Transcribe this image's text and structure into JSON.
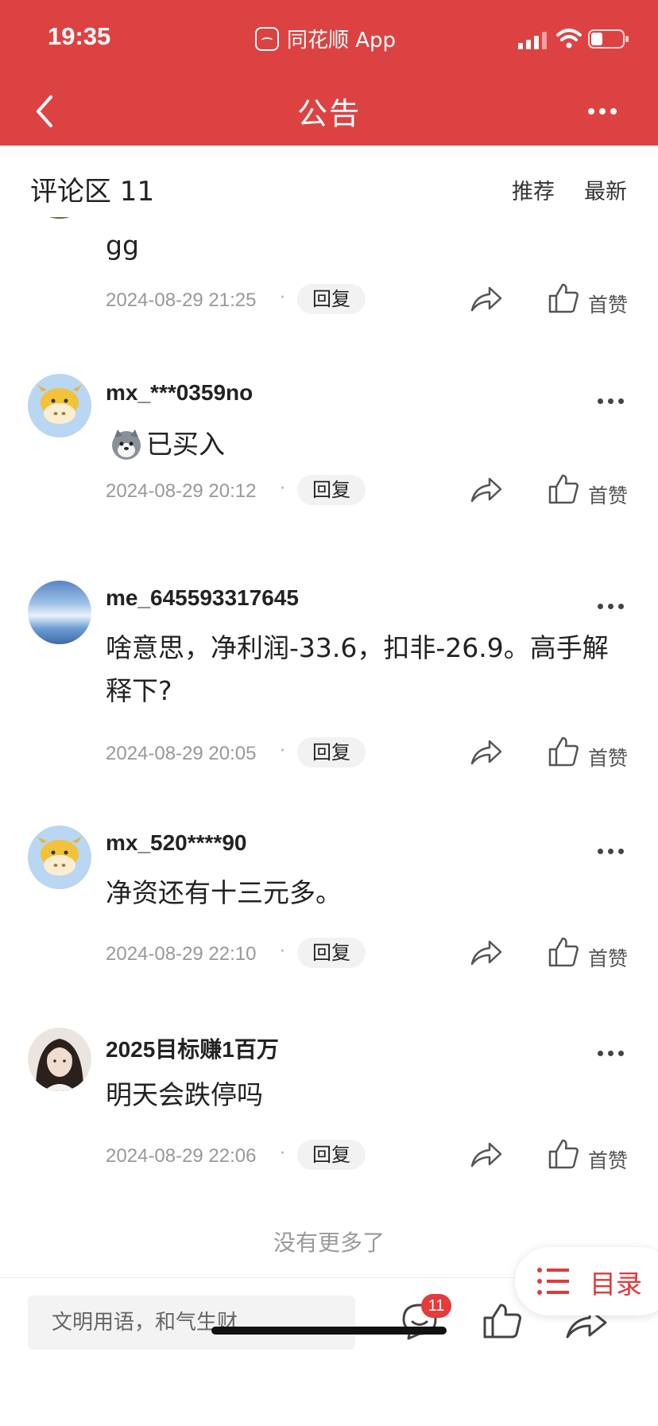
{
  "status_bar": {
    "time": "19:35",
    "app_label": "同花顺 App"
  },
  "nav": {
    "title": "公告"
  },
  "comments_header": {
    "title": "评论区 11",
    "sort_options": [
      "推荐",
      "最新"
    ]
  },
  "comments": [
    {
      "username": "",
      "text": "gg",
      "time": "2024-08-29 21:25",
      "reply_label": "回复",
      "like_label": "首赞"
    },
    {
      "username": "mx_***0359no",
      "text": "已买入",
      "time": "2024-08-29 20:12",
      "reply_label": "回复",
      "like_label": "首赞"
    },
    {
      "username": "me_645593317645",
      "text": "啥意思，净利润-33.6，扣非-26.9。高手解释下?",
      "time": "2024-08-29 20:05",
      "reply_label": "回复",
      "like_label": "首赞"
    },
    {
      "username": "mx_520****90",
      "text": "净资还有十三元多。",
      "time": "2024-08-29 22:10",
      "reply_label": "回复",
      "like_label": "首赞"
    },
    {
      "username": "2025目标赚1百万",
      "text": "明天会跌停吗",
      "time": "2024-08-29 22:06",
      "reply_label": "回复",
      "like_label": "首赞"
    }
  ],
  "footer": {
    "no_more": "没有更多了"
  },
  "bottom_bar": {
    "input_placeholder": "文明用语，和气生财",
    "comment_count": "11"
  },
  "toc": {
    "label": "目录"
  },
  "colors": {
    "brand": "#dd4242",
    "accent_red": "#e53b3b"
  }
}
